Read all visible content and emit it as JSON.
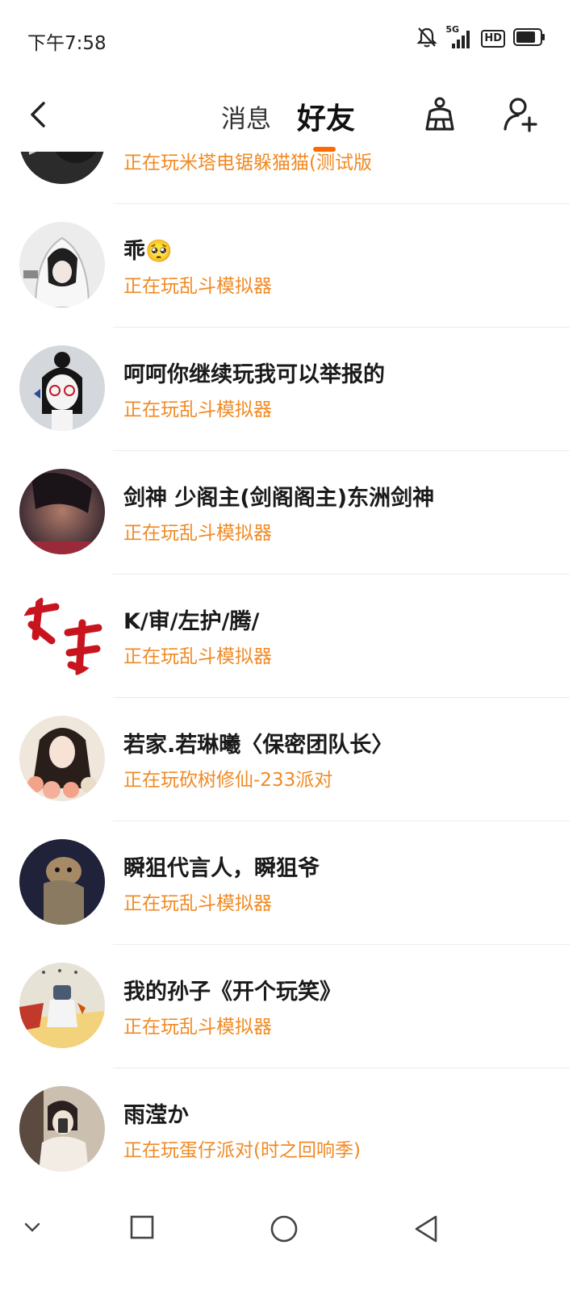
{
  "status_bar": {
    "time": "下午7:58",
    "network": "5G",
    "hd": "HD",
    "icons": [
      "bell-off-icon",
      "signal-icon",
      "battery-icon"
    ]
  },
  "header": {
    "tab_messages": "消息",
    "tab_friends": "好友",
    "active_tab": "好友",
    "accent_color": "#ff6a00",
    "icons": [
      "back-arrow-icon",
      "broom-icon",
      "add-friend-icon"
    ]
  },
  "friends": [
    {
      "name": "",
      "status": "正在玩米塔电锯躲猫猫(测试版",
      "avatar_colors": [
        "#2b2b2b",
        "#cfcfcf"
      ]
    },
    {
      "name": "乖🥺",
      "status": "正在玩乱斗模拟器",
      "avatar_colors": [
        "#e8e8e8",
        "#222222"
      ]
    },
    {
      "name": "呵呵你继续玩我可以举报的",
      "status": "正在玩乱斗模拟器",
      "avatar_colors": [
        "#d4d8dc",
        "#151515"
      ]
    },
    {
      "name": "剑神 少阁主(剑阁阁主)东洲剑神",
      "status": "正在玩乱斗模拟器",
      "avatar_colors": [
        "#3a2a36",
        "#b07a6a"
      ]
    },
    {
      "name": "K/审/左护/腾/",
      "status": "正在玩乱斗模拟器",
      "avatar_colors": [
        "#ffffff",
        "#c8141e"
      ]
    },
    {
      "name": "若家.若琳曦〈保密团队长〉",
      "status": "正在玩砍树修仙-233派对",
      "avatar_colors": [
        "#efe7dc",
        "#2a1e1a"
      ]
    },
    {
      "name": "瞬狙代言人，瞬狙爷",
      "status": "正在玩乱斗模拟器",
      "avatar_colors": [
        "#1f2238",
        "#8a7a62"
      ]
    },
    {
      "name": "我的孙子《开个玩笑》",
      "status": "正在玩乱斗模拟器",
      "avatar_colors": [
        "#e7e2d6",
        "#c0392b"
      ]
    },
    {
      "name": "雨滢か",
      "status": "正在玩蛋仔派对(时之回响季)",
      "avatar_colors": [
        "#cbbfb0",
        "#4a3a30"
      ]
    }
  ],
  "nav_bar": {
    "icons": [
      "chevron-down-icon",
      "recents-square-icon",
      "home-circle-icon",
      "back-triangle-icon"
    ]
  }
}
